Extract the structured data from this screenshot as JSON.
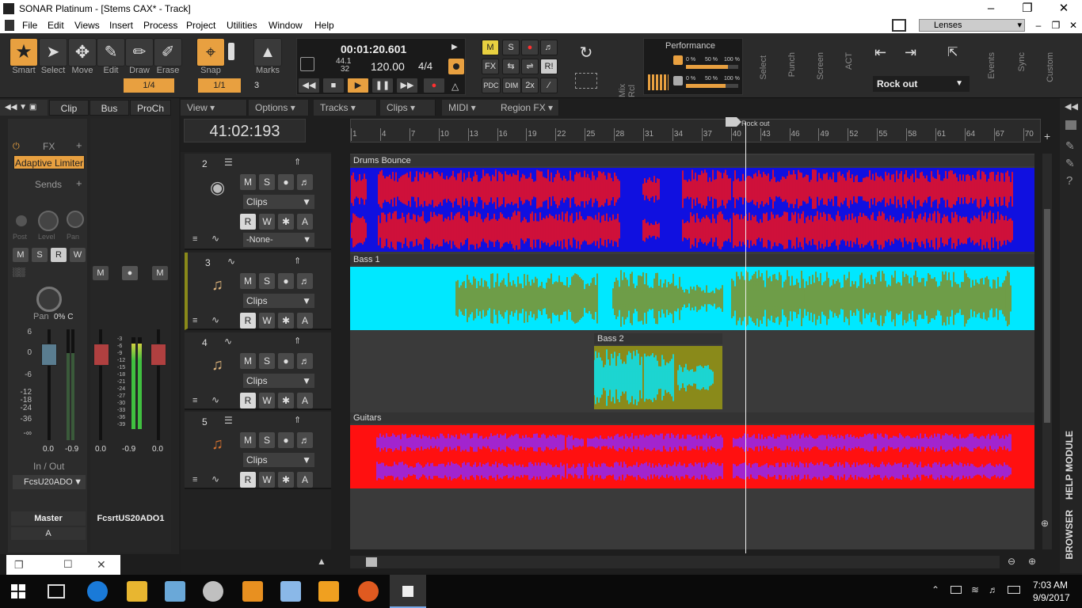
{
  "window": {
    "title": "SONAR Platinum - [Stems CAX* - Track]"
  },
  "menu": [
    "File",
    "Edit",
    "Views",
    "Insert",
    "Process",
    "Project",
    "Utilities",
    "Window",
    "Help"
  ],
  "lenses": "Lenses",
  "tools": {
    "smart": "Smart",
    "select": "Select",
    "move": "Move",
    "edit": "Edit",
    "draw": "Draw",
    "erase": "Erase",
    "snap": "Snap",
    "marks": "Marks",
    "snap_value": "1/4",
    "snap_value2": "1/1",
    "snap_count": "3"
  },
  "transport": {
    "time": "00:01:20.601",
    "sample_rate": "44.1",
    "bit_depth": "32",
    "tempo": "120.00",
    "meter": "4/4"
  },
  "mix_labels": {
    "m": "M",
    "s": "S",
    "fx": "FX",
    "pdc": "PDC",
    "dim": "DIM",
    "twox": "2x",
    "rbang": "R!"
  },
  "performance": {
    "title": "Performance",
    "p1": "0 %",
    "p2": "50 %",
    "p3": "100 %"
  },
  "strip_labels": [
    "Mix Rcl",
    "Select",
    "Punch",
    "Screen",
    "ACT",
    "Events",
    "Sync",
    "Custom"
  ],
  "markers_dropdown": "Rock out",
  "inspector": {
    "tabs": [
      "Clip",
      "Bus",
      "ProCh"
    ],
    "fx_label": "FX",
    "plugin": "Adaptive Limiter",
    "sends_label": "Sends",
    "knob_labels": [
      "Post",
      "Level",
      "Pan"
    ],
    "pan_label": "Pan",
    "pan_value": "0% C",
    "scale": [
      "6",
      "0",
      "-6",
      "-12",
      "-18",
      "-24",
      "-36",
      "-∞"
    ],
    "meter_scale": [
      "-3",
      "-6",
      "-9",
      "-12",
      "-15",
      "-18",
      "-21",
      "-24",
      "-27",
      "-30",
      "-33",
      "-36",
      "-39"
    ],
    "fader_values": [
      "0.0",
      "-0.9",
      "0.0",
      "-0.9",
      "0.0"
    ],
    "in_out": "In / Out",
    "in_device": "FcsU20ADO",
    "strip_names": [
      "Master",
      "FcsrtUS20ADO1"
    ],
    "strip_a": "A"
  },
  "view_menus": [
    "View",
    "Options",
    "Tracks",
    "Clips",
    "MIDI",
    "Region FX"
  ],
  "now_time": "41:02:193",
  "ruler": {
    "marker": "Rock out",
    "numbers": [
      "1",
      "4",
      "7",
      "10",
      "13",
      "16",
      "19",
      "22",
      "25",
      "28",
      "31",
      "34",
      "37",
      "40",
      "43",
      "46",
      "49",
      "52",
      "55",
      "58",
      "61",
      "64",
      "67",
      "70"
    ]
  },
  "tracks": [
    {
      "number": "2",
      "clips_label": "Clips",
      "none_label": "-None-",
      "clip": "Drums Bounce"
    },
    {
      "number": "3",
      "clips_label": "Clips",
      "clip": "Bass 1"
    },
    {
      "number": "4",
      "clips_label": "Clips",
      "clip": "Bass 2"
    },
    {
      "number": "5",
      "clips_label": "Clips",
      "clip": "Guitars"
    }
  ],
  "btn": {
    "m": "M",
    "s": "S",
    "r": "R",
    "w": "W",
    "a": "A"
  },
  "side_labels": {
    "browser": "BROWSER",
    "help": "HELP MODULE"
  },
  "clock": {
    "time": "7:03 AM",
    "date": "9/9/2017"
  },
  "colors": {
    "drums_bg": "#1010e0",
    "drums_wave": "#ff1010",
    "bass_bg": "#00e8ff",
    "bass_wave": "#8a8a1a",
    "guitar_bg": "#ff1010",
    "guitar_wave": "#8a2aff",
    "accent": "#e8a040"
  }
}
